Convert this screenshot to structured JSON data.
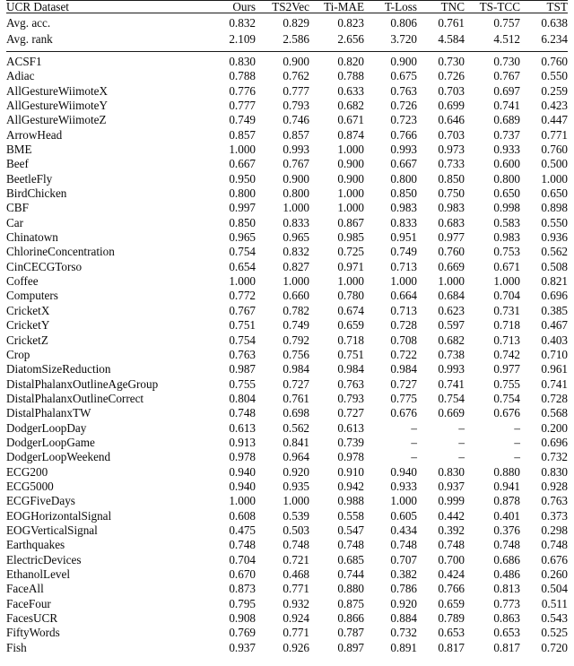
{
  "table": {
    "columns": [
      "UCR Dataset",
      "Ours",
      "TS2Vec",
      "Ti-MAE",
      "T-Loss",
      "TNC",
      "TS-TCC",
      "TST"
    ],
    "clipped_caption": "",
    "summary_rows": [
      {
        "name": "Avg. acc.",
        "values": [
          "0.832",
          "0.829",
          "0.823",
          "0.806",
          "0.761",
          "0.757",
          "0.638"
        ],
        "bold": [
          true,
          false,
          false,
          false,
          false,
          false,
          false
        ]
      },
      {
        "name": "Avg. rank",
        "values": [
          "2.109",
          "2.586",
          "2.656",
          "3.720",
          "4.584",
          "4.512",
          "6.234"
        ],
        "bold": [
          true,
          false,
          false,
          false,
          false,
          false,
          false
        ]
      }
    ],
    "rows": [
      {
        "name": "ACSF1",
        "values": [
          "0.830",
          "0.900",
          "0.820",
          "0.900",
          "0.730",
          "0.730",
          "0.760"
        ],
        "bold": [
          false,
          true,
          false,
          true,
          false,
          false,
          false
        ]
      },
      {
        "name": "Adiac",
        "values": [
          "0.788",
          "0.762",
          "0.788",
          "0.675",
          "0.726",
          "0.767",
          "0.550"
        ],
        "bold": [
          true,
          false,
          true,
          false,
          false,
          false,
          false
        ]
      },
      {
        "name": "AllGestureWiimoteX",
        "values": [
          "0.776",
          "0.777",
          "0.633",
          "0.763",
          "0.703",
          "0.697",
          "0.259"
        ],
        "bold": [
          false,
          true,
          false,
          false,
          false,
          false,
          false
        ]
      },
      {
        "name": "AllGestureWiimoteY",
        "values": [
          "0.777",
          "0.793",
          "0.682",
          "0.726",
          "0.699",
          "0.741",
          "0.423"
        ],
        "bold": [
          false,
          true,
          false,
          false,
          false,
          false,
          false
        ]
      },
      {
        "name": "AllGestureWiimoteZ",
        "values": [
          "0.749",
          "0.746",
          "0.671",
          "0.723",
          "0.646",
          "0.689",
          "0.447"
        ],
        "bold": [
          true,
          false,
          false,
          false,
          false,
          false,
          false
        ]
      },
      {
        "name": "ArrowHead",
        "values": [
          "0.857",
          "0.857",
          "0.874",
          "0.766",
          "0.703",
          "0.737",
          "0.771"
        ],
        "bold": [
          false,
          false,
          true,
          false,
          false,
          false,
          false
        ]
      },
      {
        "name": "BME",
        "values": [
          "1.000",
          "0.993",
          "1.000",
          "0.993",
          "0.973",
          "0.933",
          "0.760"
        ],
        "bold": [
          true,
          false,
          true,
          false,
          false,
          false,
          false
        ]
      },
      {
        "name": "Beef",
        "values": [
          "0.667",
          "0.767",
          "0.900",
          "0.667",
          "0.733",
          "0.600",
          "0.500"
        ],
        "bold": [
          false,
          false,
          true,
          false,
          false,
          false,
          false
        ]
      },
      {
        "name": "BeetleFly",
        "values": [
          "0.950",
          "0.900",
          "0.900",
          "0.800",
          "0.850",
          "0.800",
          "1.000"
        ],
        "bold": [
          false,
          false,
          false,
          false,
          false,
          false,
          true
        ]
      },
      {
        "name": "BirdChicken",
        "values": [
          "0.800",
          "0.800",
          "1.000",
          "0.850",
          "0.750",
          "0.650",
          "0.650"
        ],
        "bold": [
          false,
          false,
          true,
          false,
          false,
          false,
          false
        ]
      },
      {
        "name": "CBF",
        "values": [
          "0.997",
          "1.000",
          "1.000",
          "0.983",
          "0.983",
          "0.998",
          "0.898"
        ],
        "bold": [
          false,
          true,
          true,
          false,
          false,
          false,
          false
        ]
      },
      {
        "name": "Car",
        "values": [
          "0.850",
          "0.833",
          "0.867",
          "0.833",
          "0.683",
          "0.583",
          "0.550"
        ],
        "bold": [
          false,
          false,
          true,
          false,
          false,
          false,
          false
        ]
      },
      {
        "name": "Chinatown",
        "values": [
          "0.965",
          "0.965",
          "0.985",
          "0.951",
          "0.977",
          "0.983",
          "0.936"
        ],
        "bold": [
          false,
          false,
          true,
          false,
          false,
          false,
          false
        ]
      },
      {
        "name": "ChlorineConcentration",
        "values": [
          "0.754",
          "0.832",
          "0.725",
          "0.749",
          "0.760",
          "0.753",
          "0.562"
        ],
        "bold": [
          false,
          true,
          false,
          false,
          false,
          false,
          false
        ]
      },
      {
        "name": "CinCECGTorso",
        "values": [
          "0.654",
          "0.827",
          "0.971",
          "0.713",
          "0.669",
          "0.671",
          "0.508"
        ],
        "bold": [
          false,
          false,
          true,
          false,
          false,
          false,
          false
        ]
      },
      {
        "name": "Coffee",
        "values": [
          "1.000",
          "1.000",
          "1.000",
          "1.000",
          "1.000",
          "1.000",
          "0.821"
        ],
        "bold": [
          true,
          true,
          true,
          true,
          true,
          true,
          false
        ]
      },
      {
        "name": "Computers",
        "values": [
          "0.772",
          "0.660",
          "0.780",
          "0.664",
          "0.684",
          "0.704",
          "0.696"
        ],
        "bold": [
          false,
          false,
          true,
          false,
          false,
          false,
          false
        ]
      },
      {
        "name": "CricketX",
        "values": [
          "0.767",
          "0.782",
          "0.674",
          "0.713",
          "0.623",
          "0.731",
          "0.385"
        ],
        "bold": [
          false,
          true,
          false,
          false,
          false,
          false,
          false
        ]
      },
      {
        "name": "CricketY",
        "values": [
          "0.751",
          "0.749",
          "0.659",
          "0.728",
          "0.597",
          "0.718",
          "0.467"
        ],
        "bold": [
          true,
          false,
          false,
          false,
          false,
          false,
          false
        ]
      },
      {
        "name": "CricketZ",
        "values": [
          "0.754",
          "0.792",
          "0.718",
          "0.708",
          "0.682",
          "0.713",
          "0.403"
        ],
        "bold": [
          false,
          true,
          false,
          false,
          false,
          false,
          false
        ]
      },
      {
        "name": "Crop",
        "values": [
          "0.763",
          "0.756",
          "0.751",
          "0.722",
          "0.738",
          "0.742",
          "0.710"
        ],
        "bold": [
          true,
          false,
          false,
          false,
          false,
          false,
          false
        ]
      },
      {
        "name": "DiatomSizeReduction",
        "values": [
          "0.987",
          "0.984",
          "0.984",
          "0.984",
          "0.993",
          "0.977",
          "0.961"
        ],
        "bold": [
          false,
          false,
          false,
          false,
          true,
          false,
          false
        ]
      },
      {
        "name": "DistalPhalanxOutlineAgeGroup",
        "values": [
          "0.755",
          "0.727",
          "0.763",
          "0.727",
          "0.741",
          "0.755",
          "0.741"
        ],
        "bold": [
          false,
          false,
          true,
          false,
          false,
          false,
          false
        ]
      },
      {
        "name": "DistalPhalanxOutlineCorrect",
        "values": [
          "0.804",
          "0.761",
          "0.793",
          "0.775",
          "0.754",
          "0.754",
          "0.728"
        ],
        "bold": [
          true,
          false,
          false,
          false,
          false,
          false,
          false
        ]
      },
      {
        "name": "DistalPhalanxTW",
        "values": [
          "0.748",
          "0.698",
          "0.727",
          "0.676",
          "0.669",
          "0.676",
          "0.568"
        ],
        "bold": [
          true,
          false,
          false,
          false,
          false,
          false,
          false
        ]
      },
      {
        "name": "DodgerLoopDay",
        "values": [
          "0.613",
          "0.562",
          "0.613",
          "–",
          "–",
          "–",
          "0.200"
        ],
        "bold": [
          true,
          false,
          true,
          false,
          false,
          false,
          false
        ]
      },
      {
        "name": "DodgerLoopGame",
        "values": [
          "0.913",
          "0.841",
          "0.739",
          "–",
          "–",
          "–",
          "0.696"
        ],
        "bold": [
          true,
          false,
          false,
          false,
          false,
          false,
          false
        ]
      },
      {
        "name": "DodgerLoopWeekend",
        "values": [
          "0.978",
          "0.964",
          "0.978",
          "–",
          "–",
          "–",
          "0.732"
        ],
        "bold": [
          true,
          false,
          true,
          false,
          false,
          false,
          false
        ]
      },
      {
        "name": "ECG200",
        "values": [
          "0.940",
          "0.920",
          "0.910",
          "0.940",
          "0.830",
          "0.880",
          "0.830"
        ],
        "bold": [
          true,
          false,
          false,
          true,
          false,
          false,
          false
        ]
      },
      {
        "name": "ECG5000",
        "values": [
          "0.940",
          "0.935",
          "0.942",
          "0.933",
          "0.937",
          "0.941",
          "0.928"
        ],
        "bold": [
          false,
          false,
          true,
          false,
          false,
          false,
          false
        ]
      },
      {
        "name": "ECGFiveDays",
        "values": [
          "1.000",
          "1.000",
          "0.988",
          "1.000",
          "0.999",
          "0.878",
          "0.763"
        ],
        "bold": [
          true,
          true,
          false,
          true,
          false,
          false,
          false
        ]
      },
      {
        "name": "EOGHorizontalSignal",
        "values": [
          "0.608",
          "0.539",
          "0.558",
          "0.605",
          "0.442",
          "0.401",
          "0.373"
        ],
        "bold": [
          true,
          false,
          false,
          false,
          false,
          false,
          false
        ]
      },
      {
        "name": "EOGVerticalSignal",
        "values": [
          "0.475",
          "0.503",
          "0.547",
          "0.434",
          "0.392",
          "0.376",
          "0.298"
        ],
        "bold": [
          false,
          false,
          true,
          false,
          false,
          false,
          false
        ]
      },
      {
        "name": "Earthquakes",
        "values": [
          "0.748",
          "0.748",
          "0.748",
          "0.748",
          "0.748",
          "0.748",
          "0.748"
        ],
        "bold": [
          true,
          true,
          true,
          true,
          true,
          true,
          true
        ]
      },
      {
        "name": "ElectricDevices",
        "values": [
          "0.704",
          "0.721",
          "0.685",
          "0.707",
          "0.700",
          "0.686",
          "0.676"
        ],
        "bold": [
          false,
          true,
          false,
          false,
          false,
          false,
          false
        ]
      },
      {
        "name": "EthanolLevel",
        "values": [
          "0.670",
          "0.468",
          "0.744",
          "0.382",
          "0.424",
          "0.486",
          "0.260"
        ],
        "bold": [
          false,
          false,
          true,
          false,
          false,
          false,
          false
        ]
      },
      {
        "name": "FaceAll",
        "values": [
          "0.873",
          "0.771",
          "0.880",
          "0.786",
          "0.766",
          "0.813",
          "0.504"
        ],
        "bold": [
          false,
          false,
          true,
          false,
          false,
          false,
          false
        ]
      },
      {
        "name": "FaceFour",
        "values": [
          "0.795",
          "0.932",
          "0.875",
          "0.920",
          "0.659",
          "0.773",
          "0.511"
        ],
        "bold": [
          false,
          true,
          false,
          false,
          false,
          false,
          false
        ]
      },
      {
        "name": "FacesUCR",
        "values": [
          "0.908",
          "0.924",
          "0.866",
          "0.884",
          "0.789",
          "0.863",
          "0.543"
        ],
        "bold": [
          false,
          true,
          false,
          false,
          false,
          false,
          false
        ]
      },
      {
        "name": "FiftyWords",
        "values": [
          "0.769",
          "0.771",
          "0.787",
          "0.732",
          "0.653",
          "0.653",
          "0.525"
        ],
        "bold": [
          false,
          false,
          true,
          false,
          false,
          false,
          false
        ]
      },
      {
        "name": "Fish",
        "values": [
          "0.937",
          "0.926",
          "0.897",
          "0.891",
          "0.817",
          "0.817",
          "0.720"
        ],
        "bold": [
          true,
          false,
          false,
          false,
          false,
          false,
          false
        ]
      }
    ]
  }
}
